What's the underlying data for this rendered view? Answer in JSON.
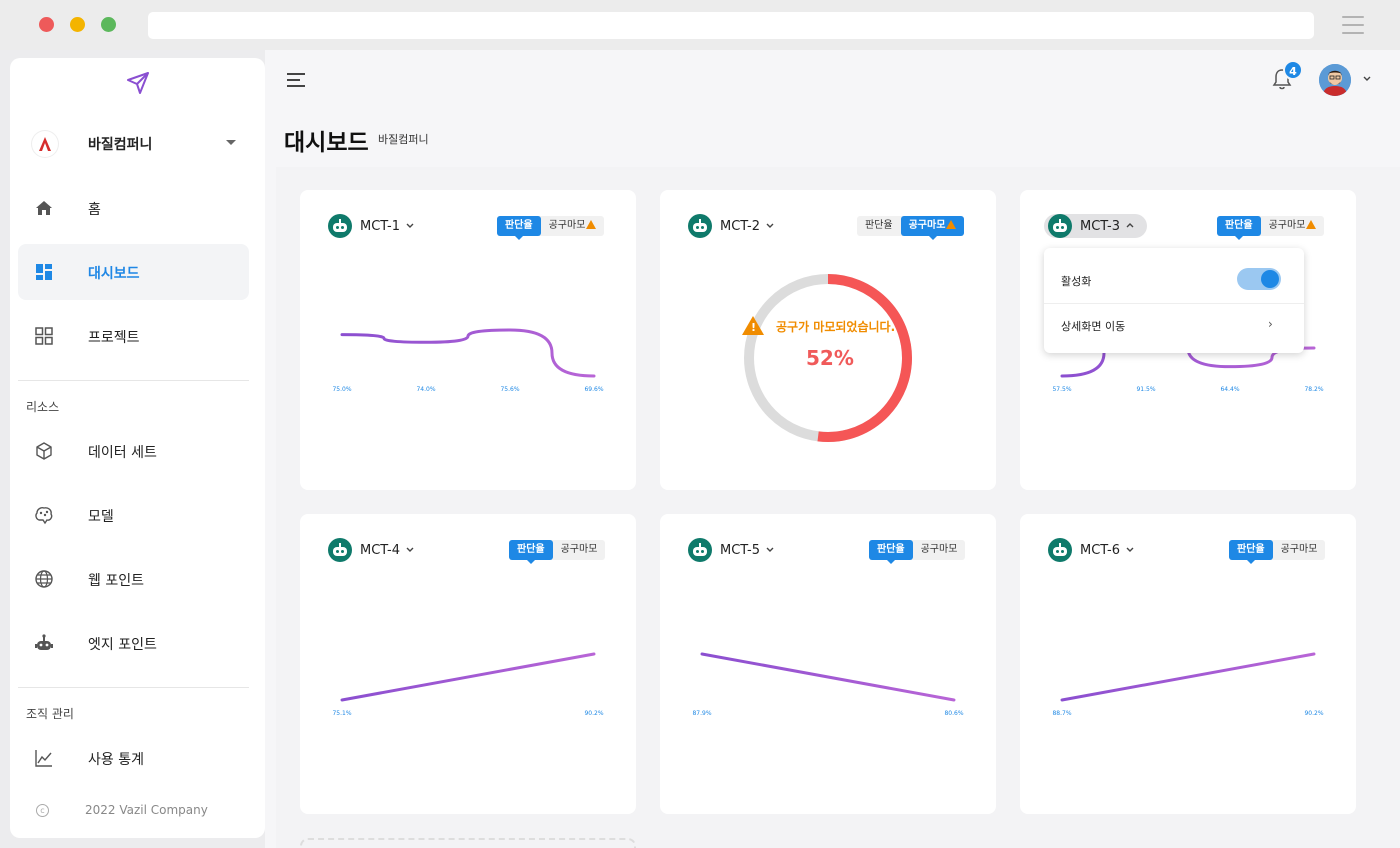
{
  "sidebar": {
    "company": "바질컴퍼니",
    "nav": [
      {
        "label": "홈"
      },
      {
        "label": "대시보드"
      },
      {
        "label": "프로젝트"
      }
    ],
    "resources_label": "리소스",
    "resources": [
      {
        "label": "데이터 세트"
      },
      {
        "label": "모델"
      },
      {
        "label": "웹 포인트"
      },
      {
        "label": "엣지 포인트"
      }
    ],
    "org_label": "조직 관리",
    "org": [
      {
        "label": "사용 통계"
      }
    ],
    "copyright": "2022 Vazil Company"
  },
  "header": {
    "notification_count": "4",
    "title": "대시보드",
    "subtitle": "바질컴퍼니"
  },
  "tabs": {
    "rate": "판단율",
    "wear": "공구마모"
  },
  "cards": [
    {
      "name": "MCT-1",
      "active_tab": "rate",
      "wear_warning": true,
      "labels": [
        "75.0%",
        "74.0%",
        "75.6%",
        "69.6%"
      ],
      "values": [
        75.0,
        74.0,
        75.6,
        69.6
      ]
    },
    {
      "name": "MCT-2",
      "active_tab": "wear",
      "wear_warning": true,
      "message": "공구가 마모되었습니다.",
      "percent": "52%",
      "wear_fraction": 0.52
    },
    {
      "name": "MCT-3",
      "active_tab": "rate",
      "wear_warning": true,
      "labels": [
        "57.5%",
        "91.5%",
        "64.4%",
        "78.2%"
      ],
      "values": [
        57.5,
        91.5,
        64.4,
        78.2
      ]
    },
    {
      "name": "MCT-4",
      "active_tab": "rate",
      "wear_warning": false,
      "labels": [
        "75.1%",
        "90.2%"
      ],
      "values": [
        75.1,
        90.2
      ]
    },
    {
      "name": "MCT-5",
      "active_tab": "rate",
      "wear_warning": false,
      "labels": [
        "87.9%",
        "80.6%"
      ],
      "values": [
        87.9,
        80.6
      ]
    },
    {
      "name": "MCT-6",
      "active_tab": "rate",
      "wear_warning": false,
      "labels": [
        "88.7%",
        "90.2%"
      ],
      "values": [
        88.7,
        90.2
      ]
    }
  ],
  "popup": {
    "activate_label": "활성화",
    "detail_label": "상세화면 이동",
    "activated": true
  },
  "colors": {
    "accent": "#1e88e5",
    "line": "#9c55d6",
    "warning": "#f08c00",
    "danger": "#f05a5a",
    "robot": "#0f7a6b"
  }
}
